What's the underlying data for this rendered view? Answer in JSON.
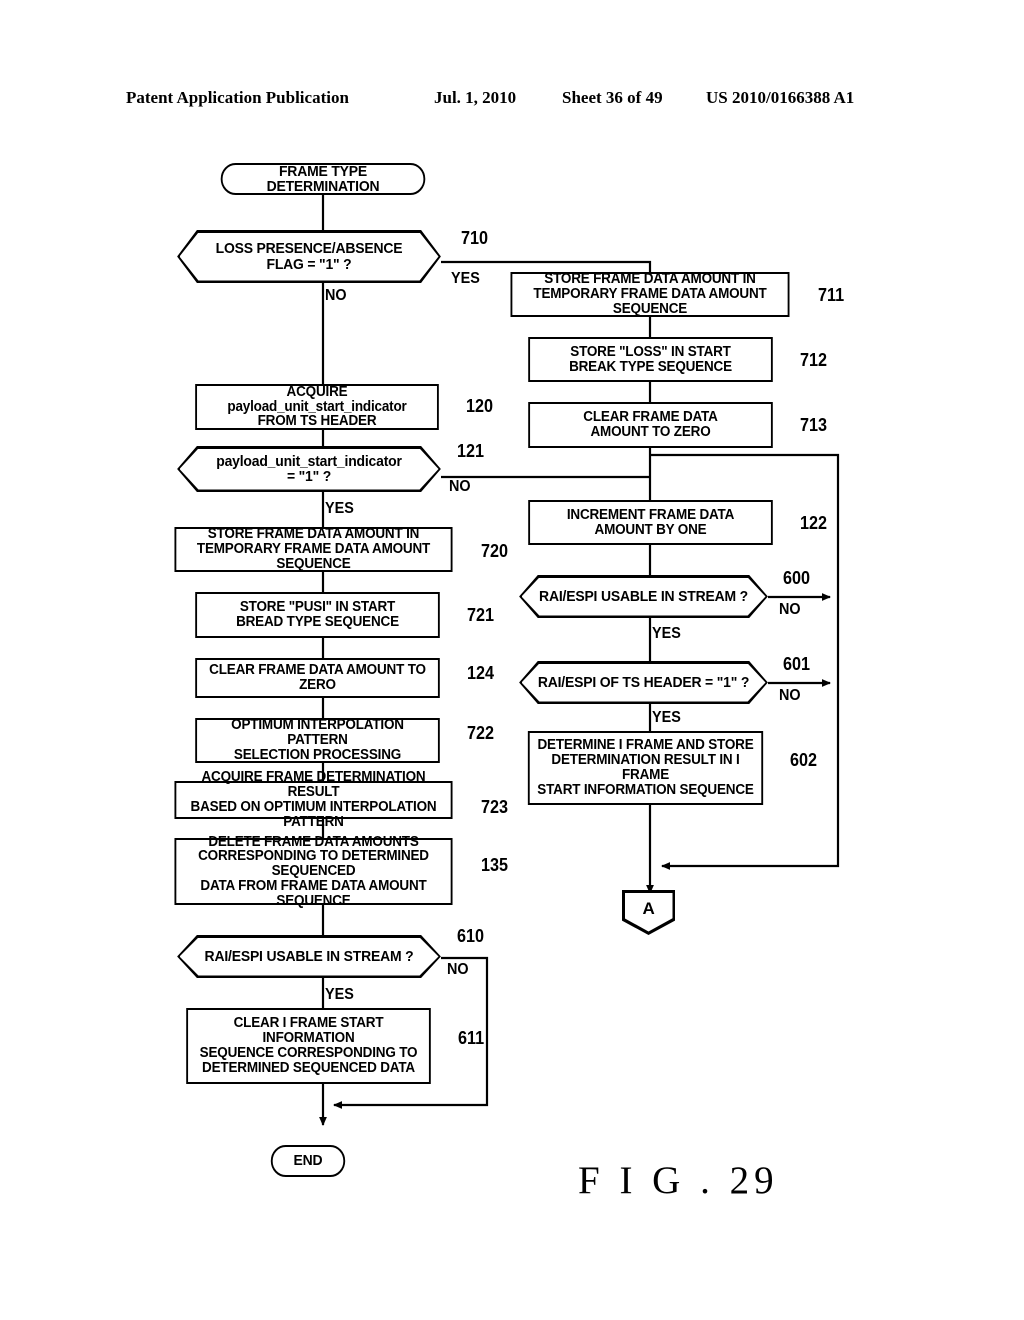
{
  "header": {
    "publication": "Patent Application Publication",
    "date": "Jul. 1, 2010",
    "sheet": "Sheet 36 of 49",
    "patent_number": "US 2010/0166388 A1"
  },
  "figure": {
    "label": "F I G . 29"
  },
  "flowchart": {
    "start": {
      "label": "FRAME TYPE DETERMINATION"
    },
    "end": {
      "label": "END"
    },
    "connector_a": {
      "label": "A"
    },
    "nodes": [
      {
        "id": "710",
        "type": "decision",
        "line1": "LOSS PRESENCE/ABSENCE",
        "line2": "FLAG = \"1\" ?",
        "ref": "710"
      },
      {
        "id": "711",
        "type": "process",
        "line1": "STORE FRAME DATA AMOUNT IN",
        "line2": "TEMPORARY FRAME DATA AMOUNT SEQUENCE",
        "ref": "711"
      },
      {
        "id": "712",
        "type": "process",
        "line1": "STORE \"LOSS\" IN START",
        "line2": "BREAK TYPE SEQUENCE",
        "ref": "712"
      },
      {
        "id": "713",
        "type": "process",
        "line1": "CLEAR FRAME DATA",
        "line2": "AMOUNT TO ZERO",
        "ref": "713"
      },
      {
        "id": "120",
        "type": "process",
        "line1": "ACQUIRE payload_unit_start_indicator",
        "line2": "FROM TS HEADER",
        "ref": "120"
      },
      {
        "id": "121",
        "type": "decision",
        "line1": "payload_unit_start_indicator",
        "line2": "= \"1\" ?",
        "ref": "121"
      },
      {
        "id": "122",
        "type": "process",
        "line1": "INCREMENT FRAME DATA",
        "line2": "AMOUNT BY ONE",
        "ref": "122"
      },
      {
        "id": "720",
        "type": "process",
        "line1": "STORE FRAME DATA AMOUNT IN",
        "line2": "TEMPORARY FRAME DATA AMOUNT SEQUENCE",
        "ref": "720"
      },
      {
        "id": "721",
        "type": "process",
        "line1": "STORE \"PUSI\" IN START",
        "line2": "BREAD TYPE SEQUENCE",
        "ref": "721"
      },
      {
        "id": "124",
        "type": "process",
        "line1": "CLEAR FRAME DATA AMOUNT TO ZERO",
        "line2": "",
        "ref": "124"
      },
      {
        "id": "722",
        "type": "process",
        "line1": "OPTIMUM INTERPOLATION PATTERN",
        "line2": "SELECTION PROCESSING",
        "ref": "722"
      },
      {
        "id": "723",
        "type": "process",
        "line1": "ACQUIRE FRAME DETERMINATION RESULT",
        "line2": "BASED ON OPTIMUM INTERPOLATION PATTERN",
        "ref": "723"
      },
      {
        "id": "135",
        "type": "process",
        "line1": "DELETE FRAME DATA AMOUNTS",
        "line2": "CORRESPONDING TO DETERMINED SEQUENCED",
        "line3": "DATA FROM FRAME DATA AMOUNT SEQUENCE",
        "ref": "135"
      },
      {
        "id": "600",
        "type": "decision",
        "line1": "RAI/ESPI USABLE IN STREAM ?",
        "line2": "",
        "ref": "600"
      },
      {
        "id": "601",
        "type": "decision",
        "line1": "RAI/ESPI OF TS HEADER = \"1\" ?",
        "line2": "",
        "ref": "601"
      },
      {
        "id": "602",
        "type": "process",
        "line1": "DETERMINE I FRAME AND STORE",
        "line2": "DETERMINATION RESULT IN I FRAME",
        "line3": "START INFORMATION SEQUENCE",
        "ref": "602"
      },
      {
        "id": "610",
        "type": "decision",
        "line1": "RAI/ESPI USABLE IN STREAM ?",
        "line2": "",
        "ref": "610"
      },
      {
        "id": "611",
        "type": "process",
        "line1": "CLEAR I FRAME START INFORMATION",
        "line2": "SEQUENCE CORRESPONDING TO",
        "line3": "DETERMINED SEQUENCED DATA",
        "ref": "611"
      }
    ],
    "branch_labels": {
      "d710_yes": "YES",
      "d710_no": "NO",
      "d121_no": "NO",
      "d121_yes": "YES",
      "d600_no": "NO",
      "d600_yes": "YES",
      "d601_no": "NO",
      "d601_yes": "YES",
      "d610_no": "NO",
      "d610_yes": "YES"
    }
  },
  "colors": {
    "ink": "#000000",
    "paper": "#ffffff"
  }
}
